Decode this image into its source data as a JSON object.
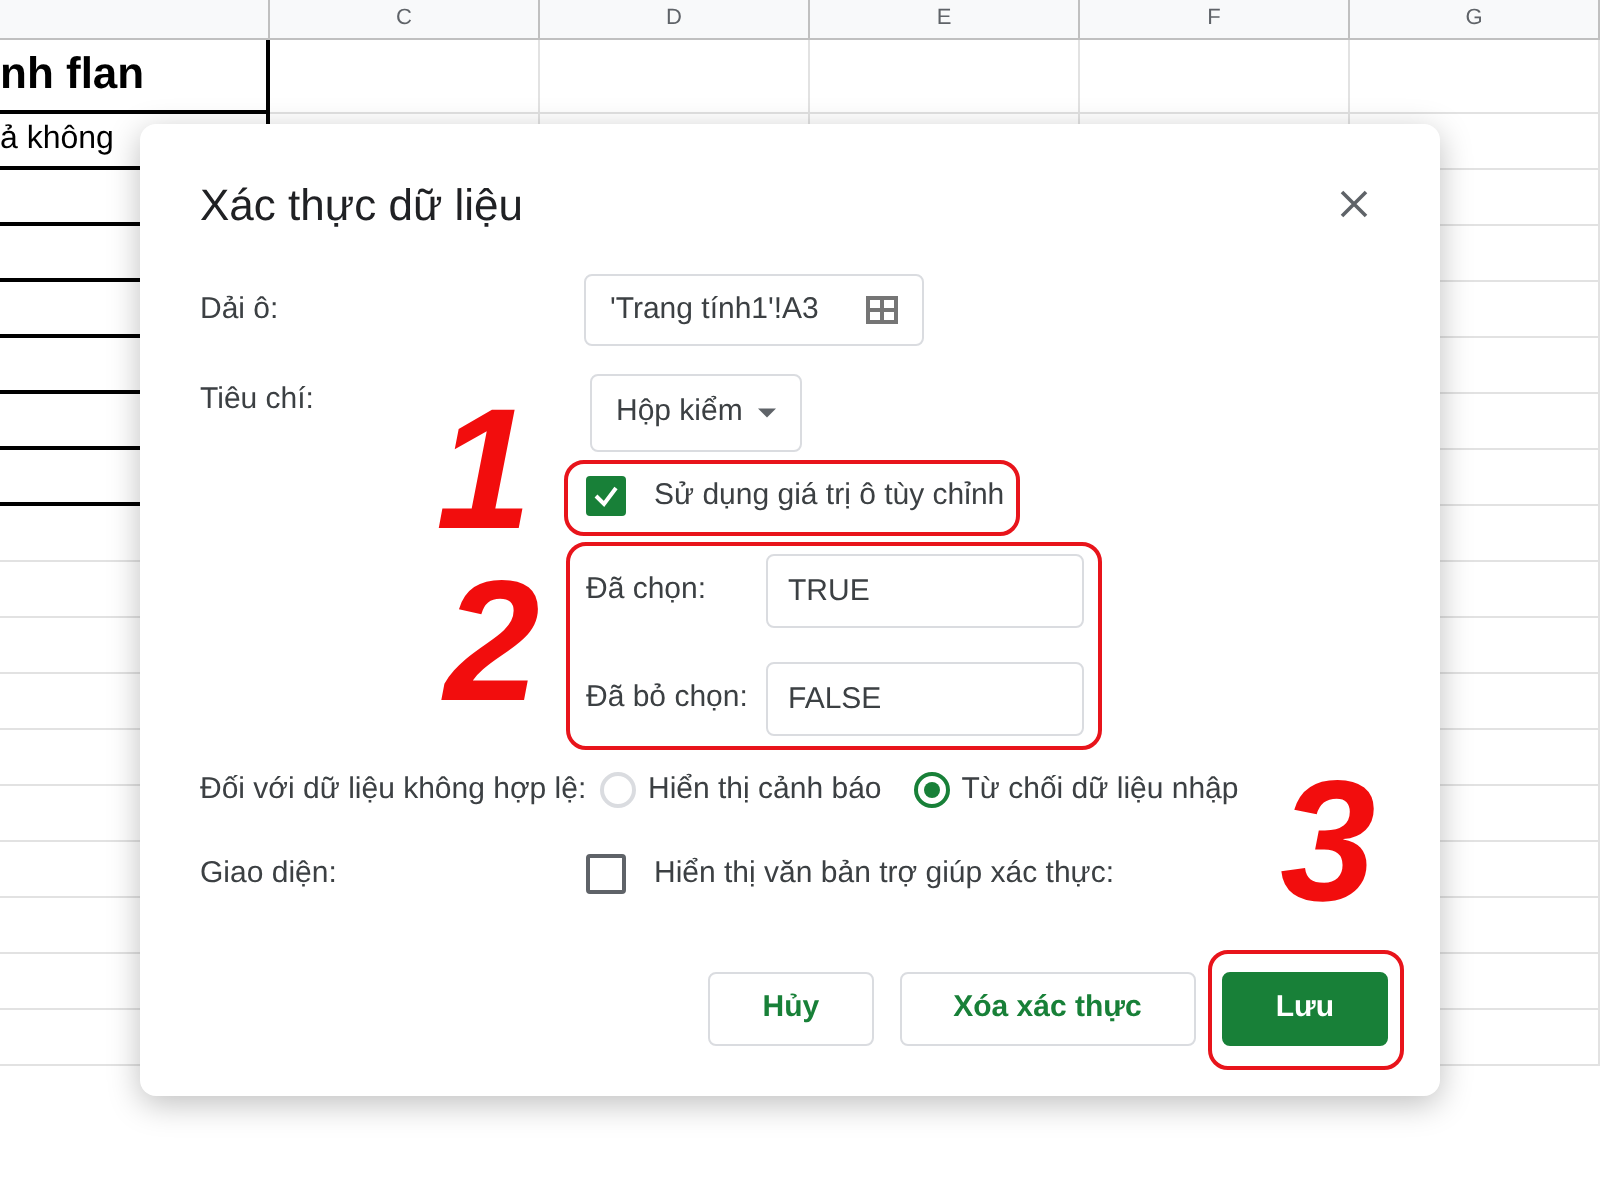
{
  "sheet": {
    "columns": [
      "C",
      "D",
      "E",
      "F",
      "G"
    ],
    "cells": [
      "nh flan",
      "ả không"
    ]
  },
  "dialog": {
    "title": "Xác thực dữ liệu",
    "range": {
      "label": "Dải ô:",
      "value": "'Trang tính1'!A3"
    },
    "criteria": {
      "label": "Tiêu chí:",
      "value": "Hộp kiểm"
    },
    "custom_values": {
      "label": "Sử dụng giá trị ô tùy chỉnh",
      "checked": true
    },
    "value_fields": [
      {
        "label": "Đã chọn:",
        "value": "TRUE"
      },
      {
        "label": "Đã bỏ chọn:",
        "value": "FALSE"
      }
    ],
    "invalid_data": {
      "label": "Đối với dữ liệu không hợp lệ:",
      "options": [
        {
          "label": "Hiển thị cảnh báo",
          "selected": false
        },
        {
          "label": "Từ chối dữ liệu nhập",
          "selected": true
        }
      ]
    },
    "appearance": {
      "label": "Giao diện:",
      "option": "Hiển thị văn bản trợ giúp xác thực:",
      "checked": false
    },
    "buttons": [
      {
        "label": "Hủy",
        "kind": "secondary"
      },
      {
        "label": "Xóa xác thực",
        "kind": "secondary"
      },
      {
        "label": "Lưu",
        "kind": "primary"
      }
    ]
  },
  "callouts": [
    "1",
    "2",
    "3"
  ]
}
